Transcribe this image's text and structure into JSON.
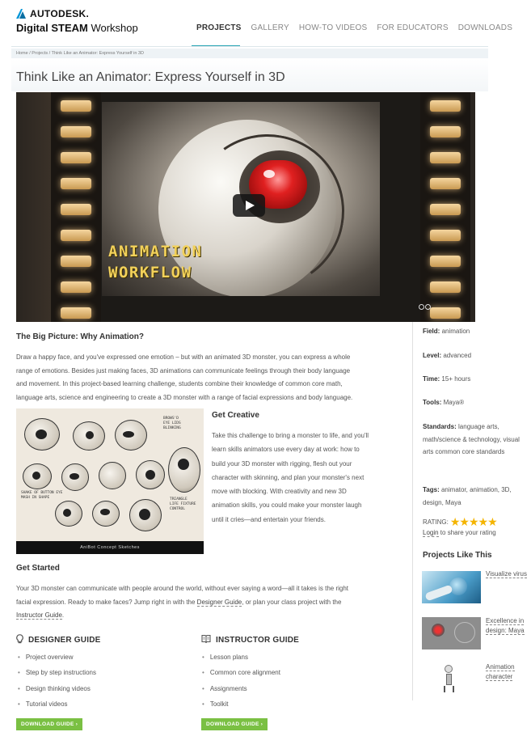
{
  "header": {
    "brand": "AUTODESK.",
    "product_bold": "Digital STEAM",
    "product_rest": " Workshop",
    "nav": [
      "PROJECTS",
      "GALLERY",
      "HOW-TO VIDEOS",
      "FOR EDUCATORS",
      "DOWNLOADS"
    ],
    "active_nav": "PROJECTS"
  },
  "breadcrumb": "Home / Projects / Think Like an Animator: Express Yourself in 3D",
  "page_title": "Think Like an Animator: Express Yourself in 3D",
  "video": {
    "overlay_line1": "ANIMATION",
    "overlay_line2": "WORKFLOW",
    "play_icon": "play-icon"
  },
  "big_picture": {
    "heading": "The Big Picture: Why Animation?",
    "lines": [
      "Draw a happy face, and you've expressed one emotion – but with an animated 3D monster, you can express a whole",
      "range of emotions. Besides just making faces, 3D animations can communicate feelings through their body language",
      "and movement. In this project-based learning challenge, students combine their knowledge of common core math,",
      "language arts, science and engineering to create a 3D monster with a range of facial expressions and body language."
    ]
  },
  "sketch": {
    "caption": "AniBot Concept Sketches",
    "notes": [
      "BROWS'D\nEYE LIDS\nBLINKING",
      "SHAKE OF BUTTON EYE\nMASH IN SHAPE",
      "TRIANGLE\nLIFE FIXTURE\nCONTROL"
    ]
  },
  "get_creative": {
    "heading": "Get Creative",
    "lines": [
      "Take this challenge to bring a monster to life, and you'll",
      "learn skills animators use every day at work: how to",
      "build your 3D monster with rigging, flesh out your",
      "character with skinning, and plan your monster's next",
      "move with blocking. With creativity and new 3D",
      "animation skills, you could make your monster laugh",
      "until it cries—and entertain your friends."
    ]
  },
  "get_started": {
    "heading": "Get Started",
    "line1": "Your 3D monster can communicate with people around the world, without ever saying a word—all it takes is the right",
    "line2_before": "facial expression. Ready to make faces? Jump right in with the ",
    "designer_link": "Designer Guide",
    "line2_after": ", or plan your class project with the",
    "instructor_link": "Instructor Guide",
    "line3_after": "."
  },
  "designer_guide": {
    "icon": "lightbulb-icon",
    "title": "DESIGNER GUIDE",
    "items": [
      "Project overview",
      "Step by step instructions",
      "Design thinking videos",
      "Tutorial videos"
    ],
    "button": "DOWNLOAD GUIDE ›"
  },
  "instructor_guide": {
    "icon": "book-icon",
    "title": "INSTRUCTOR GUIDE",
    "items": [
      "Lesson plans",
      "Common core alignment",
      "Assignments",
      "Toolkit"
    ],
    "button": "DOWNLOAD GUIDE ›"
  },
  "sidebar": {
    "field_label": "Field:",
    "field_value": " animation",
    "level_label": "Level:",
    "level_value": " advanced",
    "time_label": "Time:",
    "time_value": " 15+ hours",
    "tools_label": "Tools:",
    "tools_value": " Maya®",
    "standards_label": "Standards:",
    "standards_value": " language arts, math/science & technology, visual arts common core standards",
    "tags_label": "Tags:",
    "tags_value": " animator, animation, 3D, design, Maya",
    "rating_label": "RATING:",
    "rating_value": 5,
    "rating_max": 5,
    "login_link": "Login",
    "login_rest": " to share your rating",
    "similar_title": "Projects Like This",
    "similar": [
      "Visualize virus",
      "Excellence in design: Maya",
      "Animation character"
    ]
  },
  "colors": {
    "accent_teal": "#2aa6b5",
    "download_green": "#7ac043",
    "star_gold": "#f4b400",
    "overlay_yellow": "#f2d15a"
  }
}
